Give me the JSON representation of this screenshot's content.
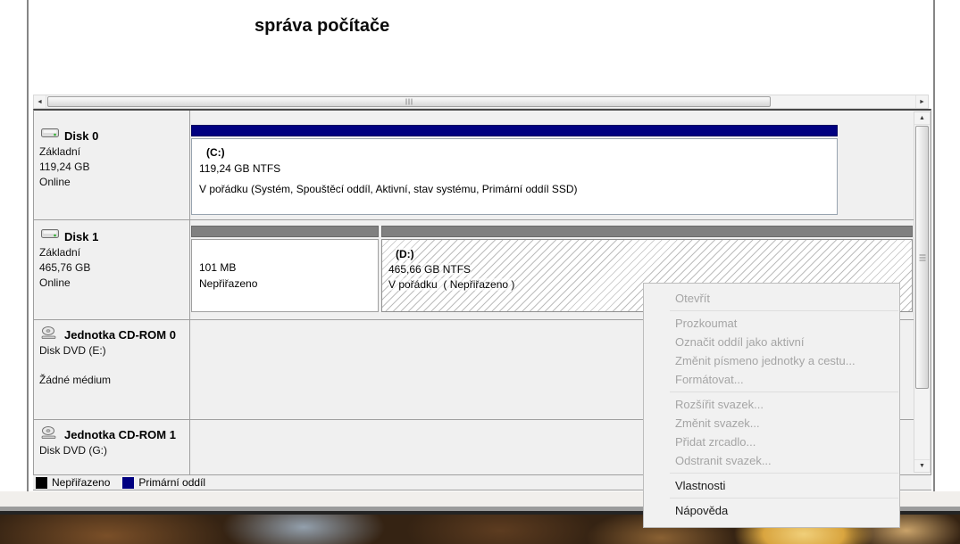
{
  "window": {
    "title": "správa počítače"
  },
  "icons": {
    "disk": "drive-icon",
    "cdrom": "disc-icon",
    "scroll_left": "◄",
    "scroll_right": "►",
    "scroll_up": "▲",
    "scroll_down": "▼"
  },
  "disk_list": {
    "disk0": {
      "name": "Disk 0",
      "type": "Základní",
      "size": "119,24 GB",
      "status": "Online"
    },
    "disk0_partition_c": {
      "label": "(C:)",
      "size": "119,24 GB NTFS",
      "status": "V pořádku (Systém, Spouštěcí oddíl, Aktivní, stav systému, Primární oddíl SSD)"
    },
    "disk1": {
      "name": "Disk 1",
      "type": "Základní",
      "size": "465,76 GB",
      "status": "Online"
    },
    "disk1_partition_unallocated": {
      "size": "101 MB",
      "status": "Nepřiřazeno"
    },
    "disk1_partition_d": {
      "label": "(D:)",
      "size": "465,66 GB NTFS",
      "status": "V pořádku  ( Nepřiřazeno )"
    },
    "cdrom0": {
      "name": "Jednotka CD-ROM 0",
      "type": "Disk DVD (E:)",
      "status": "Žádné médium"
    },
    "cdrom1": {
      "name": "Jednotka CD-ROM 1",
      "type": "Disk DVD (G:)"
    }
  },
  "legend": {
    "unallocated": {
      "label": "Nepřiřazeno",
      "color": "#000000"
    },
    "primary": {
      "label": "Primární oddíl",
      "color": "#000080"
    }
  },
  "context_menu": {
    "open": "Otevřít",
    "explore": "Prozkoumat",
    "mark_active": "Označit oddíl jako aktivní",
    "change_letter": "Změnit písmeno jednotky a cestu...",
    "format": "Formátovat...",
    "extend": "Rozšířit svazek...",
    "shrink": "Změnit svazek...",
    "add_mirror": "Přidat zrcadlo...",
    "delete_volume": "Odstranit svazek...",
    "properties": "Vlastnosti",
    "help": "Nápověda"
  },
  "colors": {
    "primary_partition": "#000080",
    "gray_partition_bar": "#808080",
    "panel_background": "#f0f0f0",
    "menu_background": "#f1f1f1",
    "menu_disabled_text": "#a5a5a5",
    "menu_text": "#1b1b1b"
  }
}
